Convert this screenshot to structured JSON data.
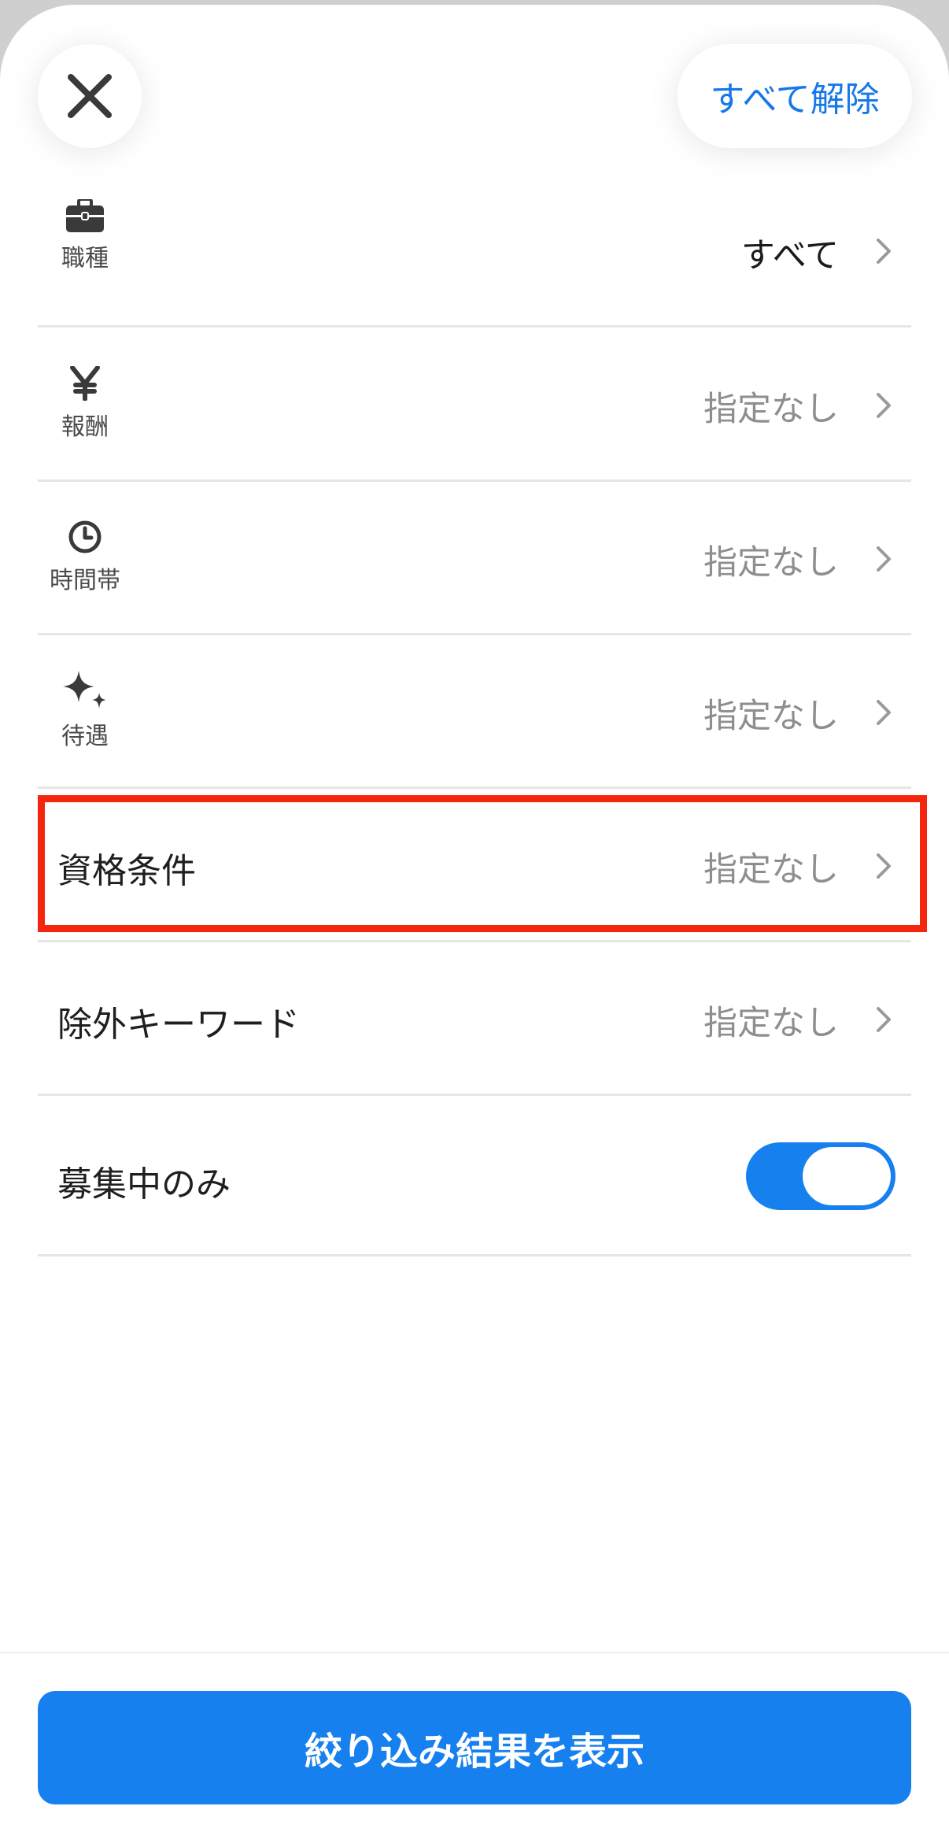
{
  "header": {
    "close_icon": "close-icon",
    "clear_all_label": "すべて解除"
  },
  "filters": [
    {
      "icon": "briefcase-icon",
      "label": "職種",
      "value": "すべて"
    },
    {
      "icon": "yen-icon",
      "label": "報酬",
      "value": "指定なし"
    },
    {
      "icon": "clock-icon",
      "label": "時間帯",
      "value": "指定なし"
    },
    {
      "icon": "sparkle-icon",
      "label": "待遇",
      "value": "指定なし"
    },
    {
      "label": "資格条件",
      "value": "指定なし"
    },
    {
      "label": "除外キーワード",
      "value": "指定なし"
    },
    {
      "label": "募集中のみ",
      "toggle": true
    }
  ],
  "footer": {
    "submit_label": "絞り込み結果を表示"
  },
  "colors": {
    "accent": "#1580ee",
    "highlight": "#f5260e"
  }
}
